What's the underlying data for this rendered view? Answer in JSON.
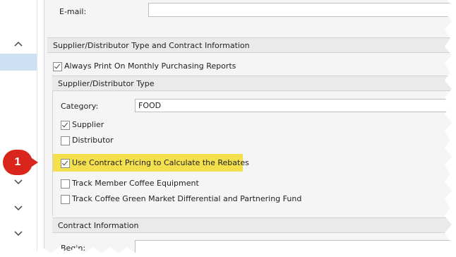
{
  "nav": {
    "chevrons": [
      "up",
      "down",
      "down",
      "down"
    ]
  },
  "email": {
    "label": "E-mail:",
    "value": ""
  },
  "main_group": {
    "title": "Supplier/Distributor Type and Contract Information"
  },
  "always_print": {
    "label": "Always Print On Monthly Purchasing Reports",
    "checked": true
  },
  "type_group": {
    "title": "Supplier/Distributor Type"
  },
  "category": {
    "label": "Category:",
    "value": "FOOD"
  },
  "checkboxes": [
    {
      "label": "Supplier",
      "checked": true
    },
    {
      "label": "Distributor",
      "checked": false
    },
    {
      "label": "Use Contract Pricing to Calculate the Rebates",
      "checked": true
    },
    {
      "label": "Track Member Coffee Equipment",
      "checked": false
    },
    {
      "label": "Track Coffee Green Market Differential and Partnering Fund",
      "checked": false
    }
  ],
  "contract_group": {
    "title": "Contract Information"
  },
  "begin": {
    "label": "Begin:",
    "value": ""
  },
  "callout": {
    "number": "1"
  },
  "colors": {
    "highlight": "#f4e04d",
    "badge": "#d9251c",
    "nav_selected": "#cde0f4"
  }
}
